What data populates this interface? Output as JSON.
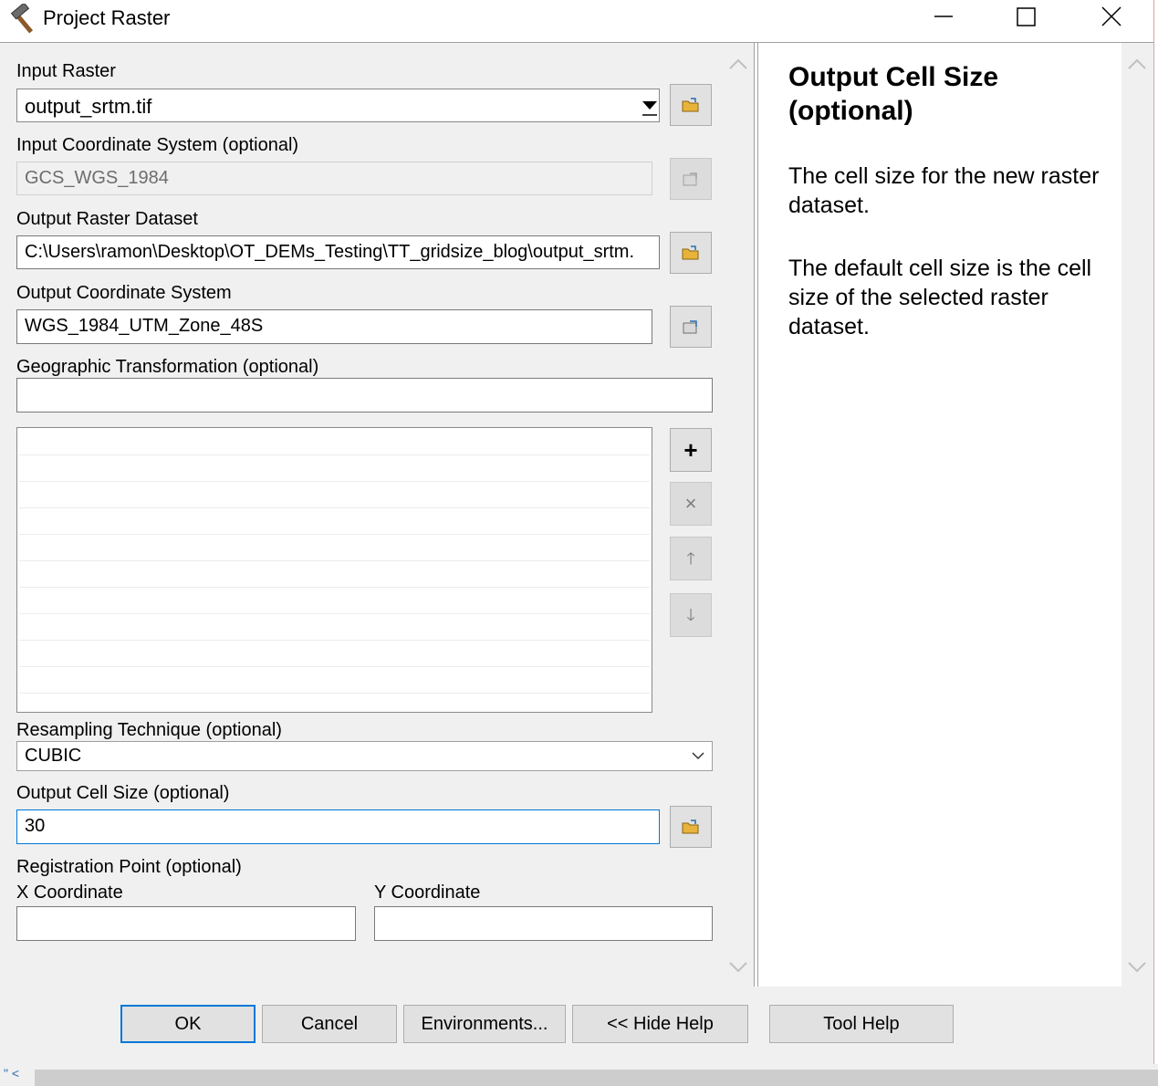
{
  "window": {
    "title": "Project Raster",
    "app_icon": "hammer-icon",
    "controls": [
      "minimize-icon",
      "maximize-icon",
      "close-icon"
    ]
  },
  "form": {
    "input_raster": {
      "label": "Input Raster",
      "value": "output_srtm.tif"
    },
    "input_coord": {
      "label": "Input Coordinate System (optional)",
      "value": "GCS_WGS_1984"
    },
    "output_raster": {
      "label": "Output Raster Dataset",
      "value": "C:\\Users\\ramon\\Desktop\\OT_DEMs_Testing\\TT_gridsize_blog\\output_srtm."
    },
    "output_coord": {
      "label": "Output Coordinate System",
      "value": "WGS_1984_UTM_Zone_48S"
    },
    "geo_transform": {
      "label": "Geographic Transformation (optional)",
      "value": ""
    },
    "list_buttons": {
      "add": "+",
      "remove": "×",
      "up": "🡑",
      "down": "🡓"
    },
    "resampling": {
      "label": "Resampling Technique (optional)",
      "value": "CUBIC"
    },
    "cell_size": {
      "label": "Output Cell Size (optional)",
      "value": "30"
    },
    "registration": {
      "label": "Registration Point (optional)",
      "x_label": "X Coordinate",
      "y_label": "Y Coordinate",
      "x_value": "",
      "y_value": ""
    }
  },
  "help": {
    "title": "Output Cell Size (optional)",
    "paragraphs": [
      "The cell size for the new raster dataset.",
      "The default cell size is the cell size of the selected raster dataset."
    ]
  },
  "buttons": {
    "ok": "OK",
    "cancel": "Cancel",
    "environments": "Environments...",
    "hide_help": "<< Hide Help",
    "tool_help": "Tool Help"
  },
  "strip": {
    "text": "\" <"
  },
  "colors": {
    "accent": "#0078d7",
    "panel": "#f0f0f0",
    "button": "#e1e1e1",
    "folder": "#e8b33a"
  }
}
